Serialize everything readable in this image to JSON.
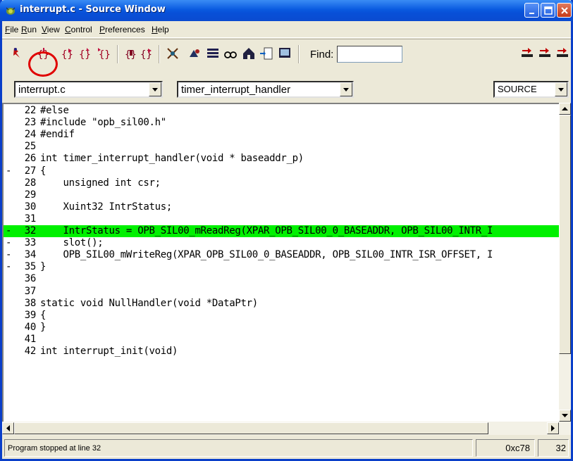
{
  "window": {
    "title": "interrupt.c - Source Window",
    "colors": {
      "title_bar": "#0a5ae0",
      "highlight_line": "#00f000",
      "annotation_circle": "#e00000"
    }
  },
  "menu": [
    "File",
    "Run",
    "View",
    "Control",
    "Preferences",
    "Help"
  ],
  "toolbar": {
    "find_label": "Find:",
    "find_value": "",
    "icons": [
      "run-icon",
      "step-icon",
      "next-icon",
      "finish-icon",
      "continue-icon",
      "step-asm-icon",
      "next-asm-icon",
      "registers-icon",
      "memory-icon",
      "stack-icon",
      "watch-icon",
      "locals-icon",
      "breakpoints-icon",
      "console-icon",
      "frame-up-icon",
      "frame-down-icon",
      "frame-bottom-icon"
    ]
  },
  "combos": {
    "file": "interrupt.c",
    "function": "timer_interrupt_handler",
    "mode": "SOURCE"
  },
  "source_lines": [
    {
      "mark": "",
      "num": "22",
      "code": "#else",
      "hl": false
    },
    {
      "mark": "",
      "num": "23",
      "code": "#include \"opb_sil00.h\"",
      "hl": false
    },
    {
      "mark": "",
      "num": "24",
      "code": "#endif",
      "hl": false
    },
    {
      "mark": "",
      "num": "25",
      "code": "",
      "hl": false
    },
    {
      "mark": "",
      "num": "26",
      "code": "int timer_interrupt_handler(void * baseaddr_p)",
      "hl": false
    },
    {
      "mark": "-",
      "num": "27",
      "code": "{",
      "hl": false
    },
    {
      "mark": "",
      "num": "28",
      "code": "    unsigned int csr;",
      "hl": false
    },
    {
      "mark": "",
      "num": "29",
      "code": "",
      "hl": false
    },
    {
      "mark": "",
      "num": "30",
      "code": "    Xuint32 IntrStatus;",
      "hl": false
    },
    {
      "mark": "",
      "num": "31",
      "code": "",
      "hl": false
    },
    {
      "mark": "-",
      "num": "32",
      "code": "    IntrStatus = OPB_SIL00_mReadReg(XPAR_OPB_SIL00_0_BASEADDR, OPB_SIL00_INTR_I",
      "hl": true
    },
    {
      "mark": "-",
      "num": "33",
      "code": "    slot();",
      "hl": false
    },
    {
      "mark": "-",
      "num": "34",
      "code": "    OPB_SIL00_mWriteReg(XPAR_OPB_SIL00_0_BASEADDR, OPB_SIL00_INTR_ISR_OFFSET, I",
      "hl": false
    },
    {
      "mark": "-",
      "num": "35",
      "code": "}",
      "hl": false
    },
    {
      "mark": "",
      "num": "36",
      "code": "",
      "hl": false
    },
    {
      "mark": "",
      "num": "37",
      "code": "",
      "hl": false
    },
    {
      "mark": "",
      "num": "38",
      "code": "static void NullHandler(void *DataPtr)",
      "hl": false
    },
    {
      "mark": "",
      "num": "39",
      "code": "{",
      "hl": false
    },
    {
      "mark": "",
      "num": "40",
      "code": "}",
      "hl": false
    },
    {
      "mark": "",
      "num": "41",
      "code": "",
      "hl": false
    },
    {
      "mark": "",
      "num": "42",
      "code": "int interrupt_init(void)",
      "hl": false
    }
  ],
  "status": {
    "message": "Program stopped at line 32",
    "address": "0xc78",
    "line": "32"
  }
}
